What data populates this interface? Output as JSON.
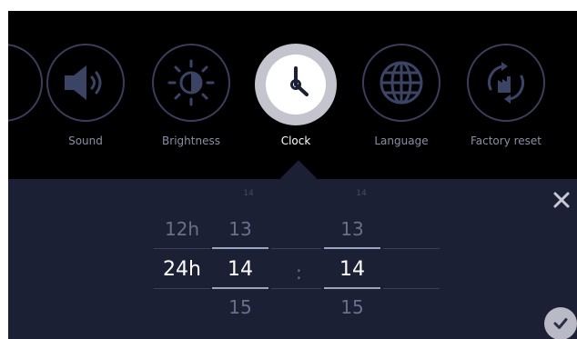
{
  "settings_menu": {
    "items": [
      {
        "label": "Sound",
        "icon": "speaker-icon"
      },
      {
        "label": "Brightness",
        "icon": "sun-icon"
      },
      {
        "label": "Clock",
        "icon": "clock-icon",
        "active": true
      },
      {
        "label": "Language",
        "icon": "globe-icon"
      },
      {
        "label": "Factory reset",
        "icon": "factory-reset-icon"
      }
    ]
  },
  "clock_picker": {
    "format_options": [
      "12h",
      "24h"
    ],
    "selected_format": "24h",
    "hours": {
      "prev": "13",
      "selected": "14",
      "next": "15"
    },
    "separator": ":",
    "minutes": {
      "prev": "13",
      "selected": "14",
      "next": "15"
    }
  },
  "colors": {
    "background": "#000000",
    "panel": "#1c2035",
    "active_circle": "#c4c4cf",
    "inactive_border": "#3a3e5a"
  }
}
